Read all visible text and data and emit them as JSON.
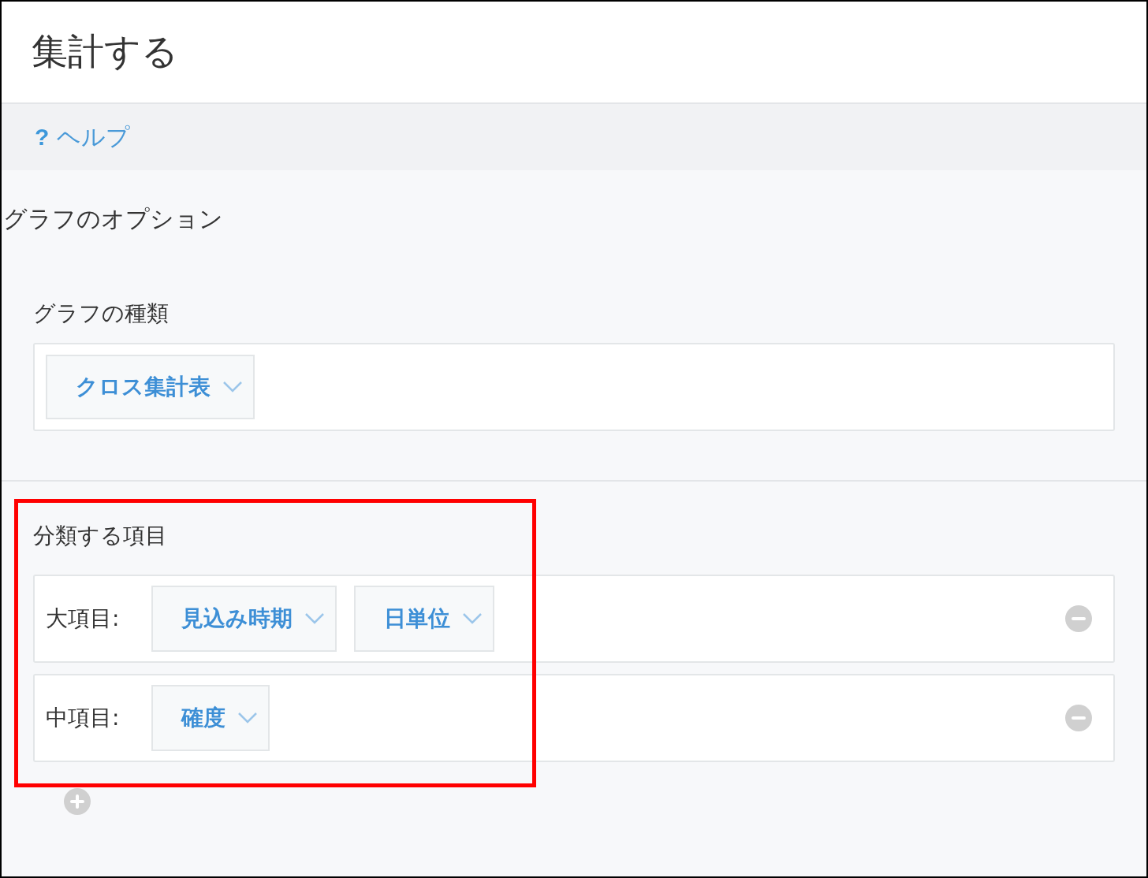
{
  "page_title": "集計する",
  "help_link": {
    "icon_text": "?",
    "label": "ヘルプ"
  },
  "section_title": "グラフのオプション",
  "chart_type": {
    "label": "グラフの種類",
    "dropdown": "クロス集計表"
  },
  "grouping": {
    "label": "分類する項目",
    "highlighted": true,
    "rows": [
      {
        "label": "大項目:",
        "dropdowns": [
          "見込み時期",
          "日単位"
        ]
      },
      {
        "label": "中項目:",
        "dropdowns": [
          "確度"
        ]
      }
    ]
  }
}
